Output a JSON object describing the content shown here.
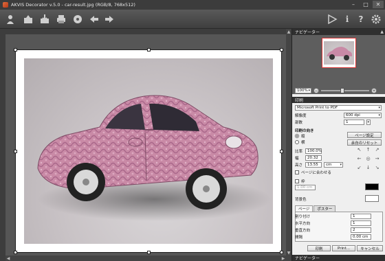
{
  "window": {
    "title": "AKVIS Decorator v.5.0 - car-result.jpg (RGB/8, 768x512)",
    "minimize": "–",
    "maximize": "□",
    "close": "✕"
  },
  "toolbar": {
    "icons_left": [
      "logo-icon",
      "open-icon",
      "save-icon",
      "print-icon",
      "share-icon",
      "undo-arrow-icon",
      "redo-arrow-icon"
    ],
    "icons_right": [
      "run-icon",
      "info-icon",
      "help-icon",
      "settings-icon"
    ],
    "info_glyph": "i",
    "help_glyph": "?"
  },
  "navigator": {
    "header": "ナビゲーター",
    "zoom_value": "100%",
    "zoom_minus": "−",
    "zoom_plus": "+"
  },
  "print": {
    "header": "印刷",
    "printer": "Microsoft Print to PDF",
    "resolution_label": "解像度",
    "resolution_value": "600 dpi",
    "copies_label": "部数",
    "copies_value": "1",
    "orientation_label": "印刷の向き",
    "orientation_portrait": "縦",
    "orientation_landscape": "横",
    "page_setup_button": "ページ設定",
    "reset_margins_button": "余白のリセット",
    "scale_label": "比率",
    "scale_value": "100.0%",
    "width_label": "幅",
    "width_value": "20.32",
    "height_label": "高さ",
    "height_value": "13.55",
    "unit_value": "cm",
    "fit_page_label": "ページに合わせる",
    "frame_label": "枠",
    "frame_width_value": "1.00 cm",
    "background_label": "背景色",
    "tabs": [
      "ページ",
      "ポスター"
    ],
    "layout_label": "割り付け",
    "layout_value": "1",
    "horizontal_label": "水平方向",
    "horizontal_value": "1",
    "vertical_label": "垂直方向",
    "vertical_value": "2",
    "spacing_label": "間隔",
    "spacing_value": "0.00 cm",
    "print_button": "印刷",
    "print_dialog_button": "Print...",
    "cancel_button": "キャンセル",
    "pad_glyphs": {
      "nw": "↖",
      "n": "↑",
      "ne": "↗",
      "w": "←",
      "c": "◎",
      "e": "→",
      "sw": "↙",
      "s": "↓",
      "se": "↘"
    }
  },
  "footer": {
    "navigator_label": "ナビゲーター"
  },
  "colors": {
    "frame_color": "#000000",
    "background_color": "#ffffff",
    "car_color": "#c98aa6"
  }
}
